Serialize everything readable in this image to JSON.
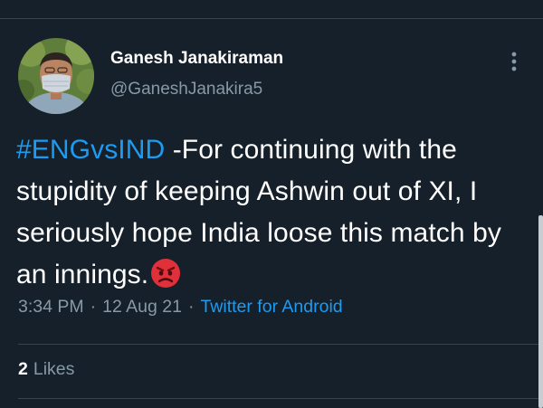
{
  "tweet": {
    "author": {
      "display_name": "Ganesh Janakiraman",
      "handle": "@GaneshJanakira5",
      "avatar_icon": "profile-photo-masked-man"
    },
    "more_icon": "vertical-ellipsis-icon",
    "text": {
      "hashtag": "#ENGvsIND",
      "body": " -For continuing with the stupidity of keeping Ashwin out of XI, I seriously hope India loose this match by an innings.",
      "emoji": "angry-face-emoji"
    },
    "meta": {
      "time": "3:34 PM",
      "date": "12 Aug 21",
      "separator": "·",
      "source": "Twitter for Android"
    },
    "stats": {
      "likes_count": "2",
      "likes_label": "Likes"
    }
  },
  "colors": {
    "background": "#15202b",
    "text": "#ffffff",
    "secondary_text": "#8899a6",
    "link": "#1d9bf0",
    "divider": "#38444d"
  }
}
